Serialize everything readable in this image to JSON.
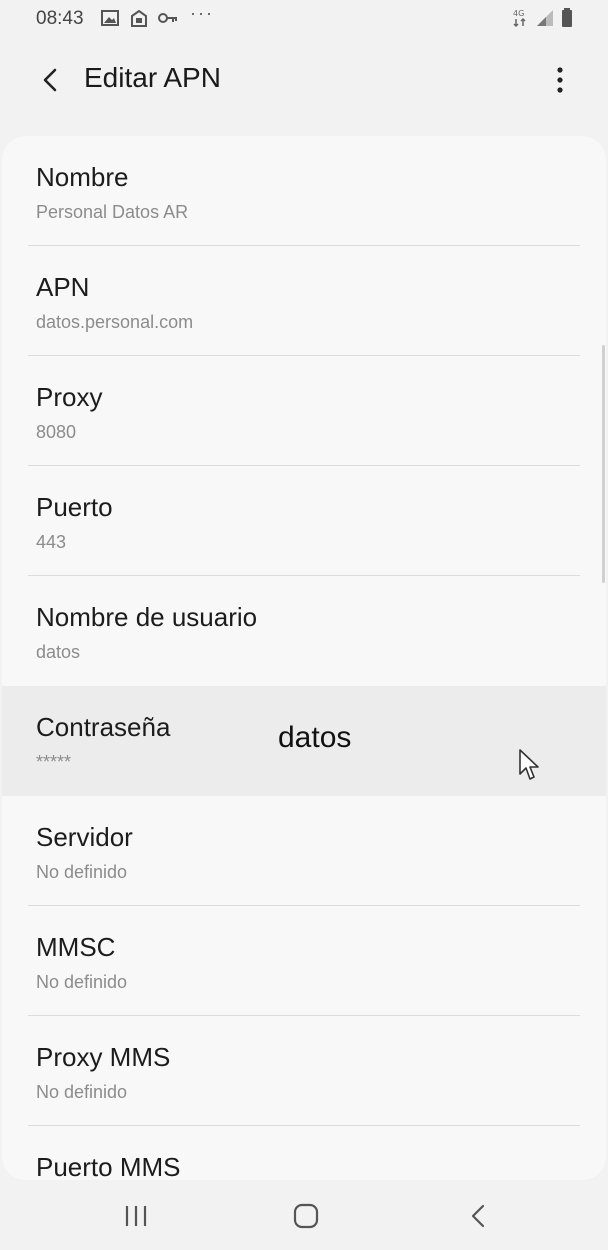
{
  "status_bar": {
    "time": "08:43",
    "left_icons": [
      "image-icon",
      "store-icon",
      "key-icon",
      "more-dots-icon"
    ],
    "right_icons": [
      "network-4g-icon",
      "signal-icon",
      "battery-icon"
    ]
  },
  "app_bar": {
    "title": "Editar APN",
    "back_icon": "back-arrow-icon",
    "menu_icon": "more-vertical-icon"
  },
  "settings": [
    {
      "label": "Nombre",
      "value": "Personal Datos AR"
    },
    {
      "label": "APN",
      "value": "datos.personal.com"
    },
    {
      "label": "Proxy",
      "value": "8080"
    },
    {
      "label": "Puerto",
      "value": "443"
    },
    {
      "label": "Nombre de usuario",
      "value": "datos"
    },
    {
      "label": "Contraseña",
      "value": "*****"
    },
    {
      "label": "Servidor",
      "value": "No definido"
    },
    {
      "label": "MMSC",
      "value": "No definido"
    },
    {
      "label": "Proxy MMS",
      "value": "No definido"
    },
    {
      "label": "Puerto MMS",
      "value": ""
    }
  ],
  "overlay": {
    "text": "datos"
  },
  "nav_bar": {
    "icons": [
      "recent-apps-icon",
      "home-icon",
      "back-icon"
    ]
  },
  "colors": {
    "background": "#f2f2f2",
    "card": "#f8f8f8",
    "highlight": "#ececec",
    "secondary_text": "#8c8c8c"
  }
}
